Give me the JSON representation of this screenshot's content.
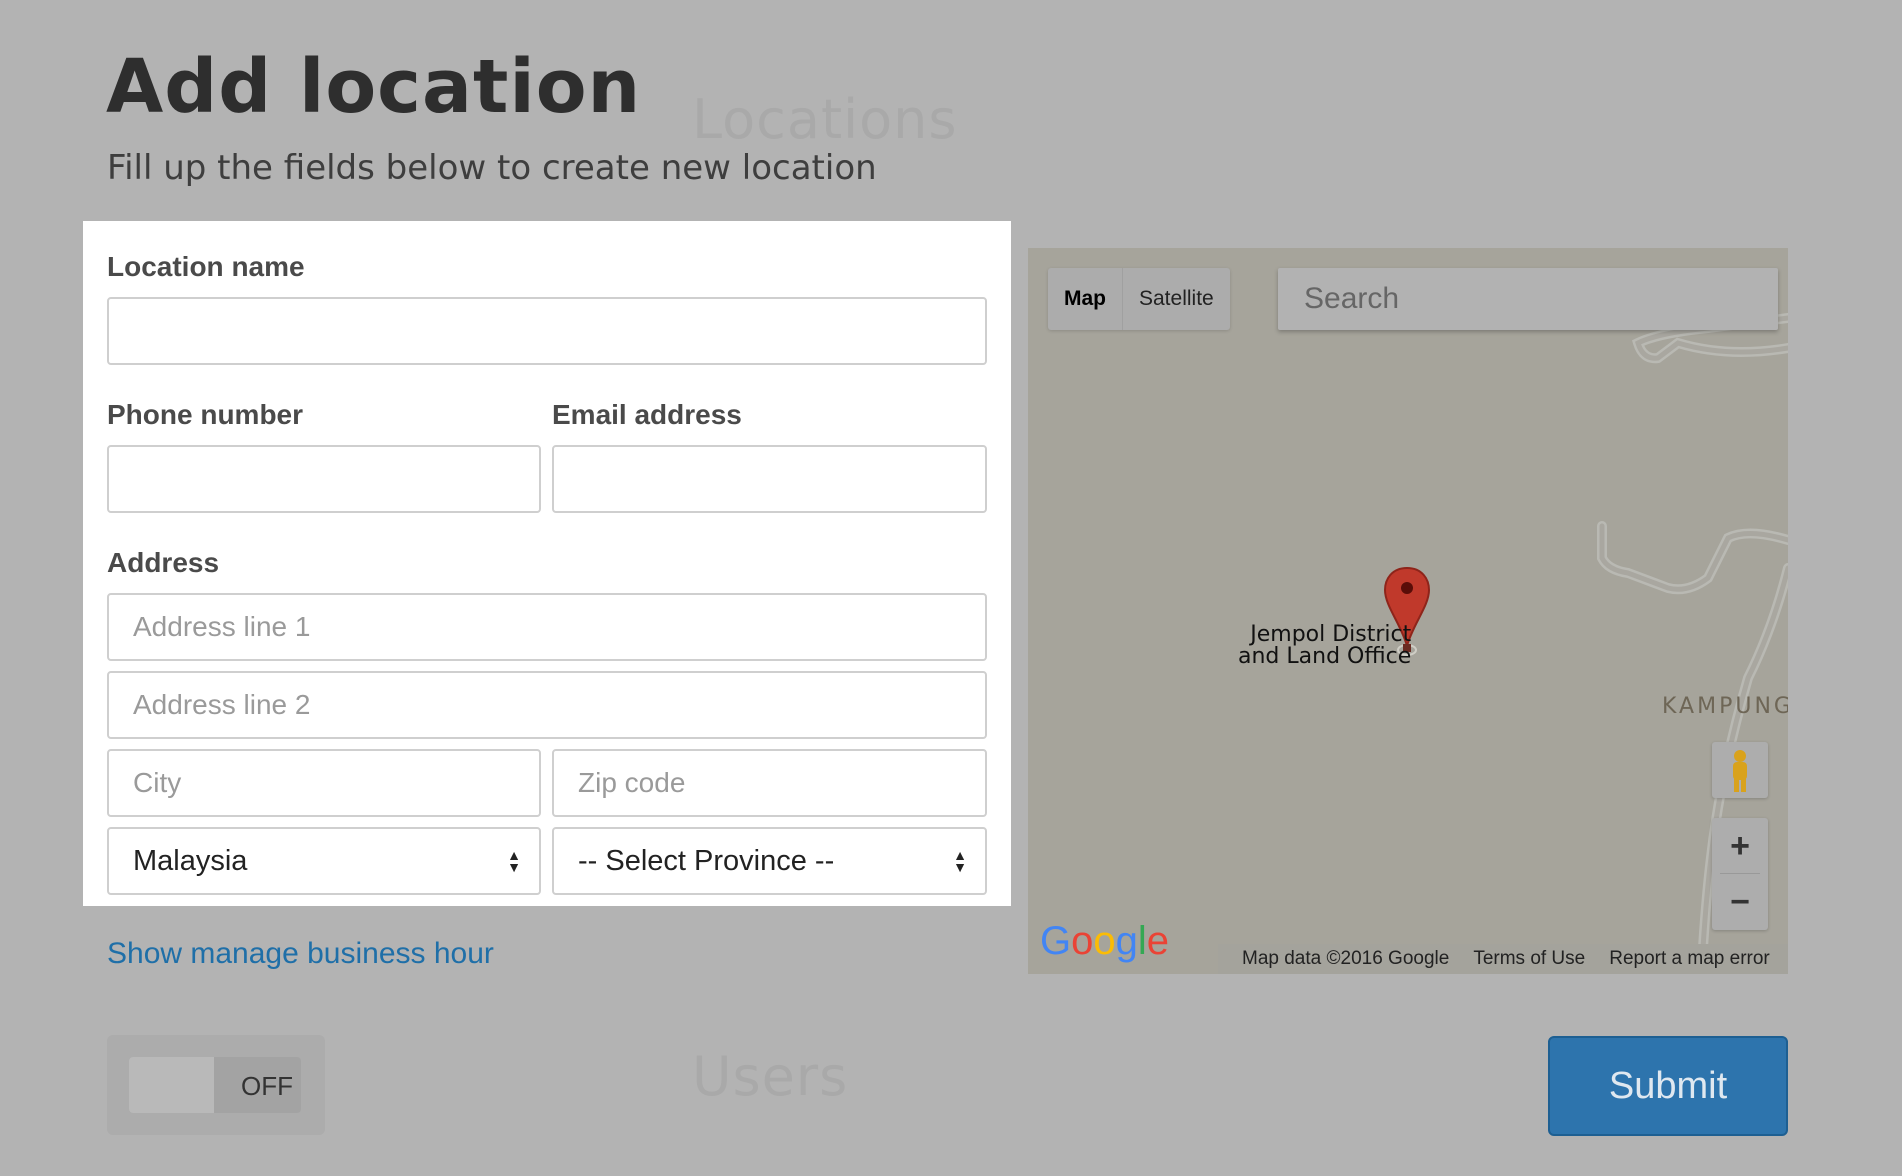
{
  "page": {
    "title": "Add location",
    "subtitle": "Fill up the fields below to create new location"
  },
  "background": {
    "section_locations": "Locations",
    "section_users": "Users"
  },
  "form": {
    "location_name_label": "Location name",
    "location_name_value": "",
    "phone_label": "Phone number",
    "phone_value": "",
    "email_label": "Email address",
    "email_value": "",
    "address_label": "Address",
    "address_line1_placeholder": "Address line 1",
    "address_line2_placeholder": "Address line 2",
    "city_placeholder": "City",
    "zip_placeholder": "Zip code",
    "country_selected": "Malaysia",
    "province_selected": "-- Select Province --"
  },
  "manage_business_hour_link": "Show manage business hour",
  "toggle": {
    "label": "OFF",
    "on": false
  },
  "submit_label": "Submit",
  "map": {
    "type_map": "Map",
    "type_satellite": "Satellite",
    "search_placeholder": "Search",
    "place_label_line1": "Jempol District",
    "place_label_line2": "and Land Office",
    "area_label": "KAMPUNG",
    "zoom_in": "+",
    "zoom_out": "−",
    "footer_data": "Map data ©2016 Google",
    "footer_terms": "Terms of Use",
    "footer_report": "Report a map error",
    "logo_text": "Google",
    "logo_colors": [
      "#4285F4",
      "#EA4335",
      "#FBBC05",
      "#4285F4",
      "#34A853",
      "#EA4335"
    ]
  },
  "colors": {
    "overlay": "#b3b3b3",
    "link": "#1f6fa8",
    "submit": "#2d74ad",
    "marker": "#c0392b"
  }
}
